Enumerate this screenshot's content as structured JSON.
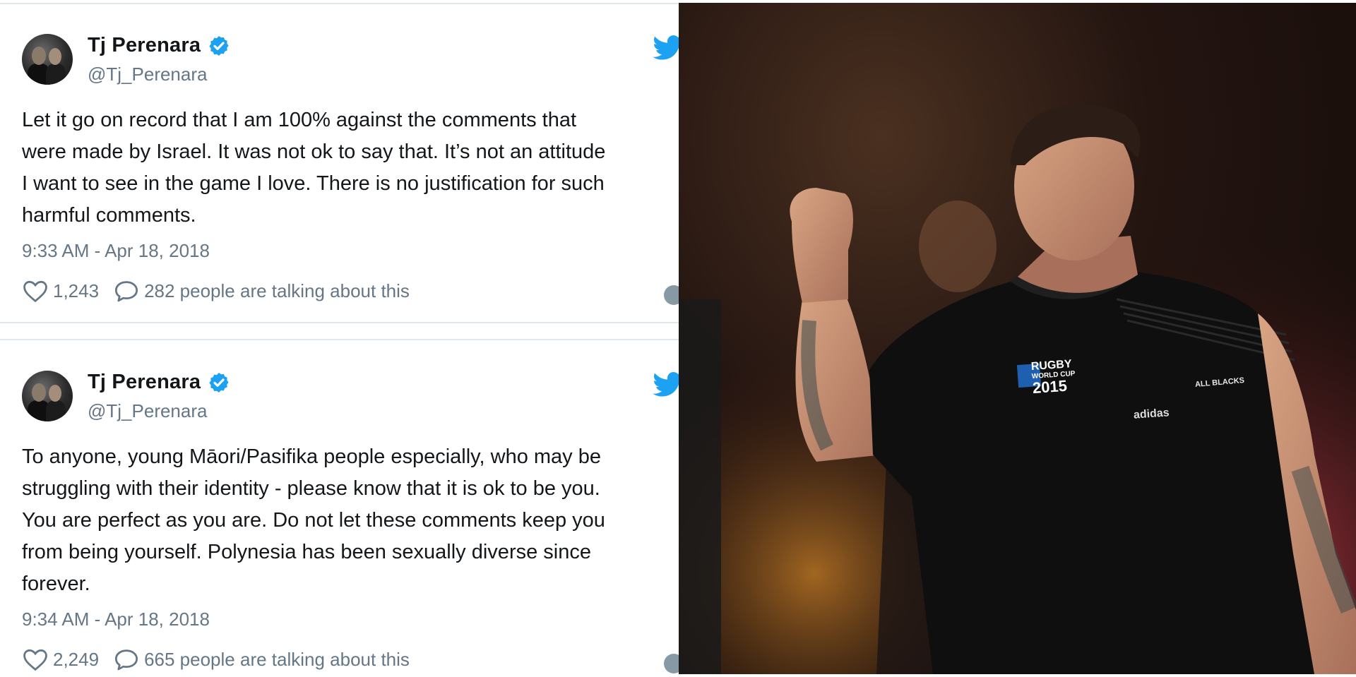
{
  "tweets": [
    {
      "display_name": "Tj Perenara",
      "handle": "@Tj_Perenara",
      "lines": [
        "Let it go on record that I am 100% against the comments that",
        "were made by Israel. It was not ok to say that. It’s not an attitude",
        "I want to see in the game I love. There is no justification for such",
        "harmful comments."
      ],
      "timestamp": "9:33 AM - Apr 18, 2018",
      "likes": "1,243",
      "talking": "282 people are talking about this"
    },
    {
      "display_name": "Tj Perenara",
      "handle": "@Tj_Perenara",
      "lines": [
        "To anyone, young Māori/Pasifika people especially, who may be",
        "struggling with their identity - please know that it is ok to be you.",
        "You are perfect as you are. Do not let these comments keep you",
        "from being yourself. Polynesia has been sexually diverse since",
        "forever."
      ],
      "timestamp": "9:34 AM - Apr 18, 2018",
      "likes": "2,249",
      "talking": "665 people are talking about this"
    }
  ],
  "photo": {
    "patch_line1": "RUGBY",
    "patch_line2": "WORLD CUP",
    "patch_year": "2015",
    "team_label": "ALL BLACKS",
    "sponsor": "adidas"
  },
  "colors": {
    "verified": "#1da1f2",
    "twitter_bird": "#1da1f2",
    "text": "#14171a",
    "muted": "#657786"
  }
}
